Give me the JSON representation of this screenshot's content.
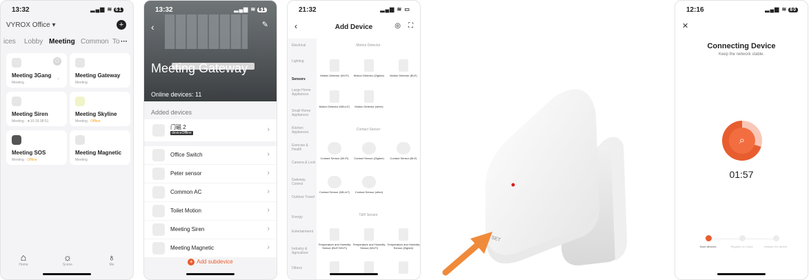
{
  "screen1": {
    "time": "13:32",
    "battery": "61",
    "office": "VYROX Office ▾",
    "add_icon": "plus-icon",
    "tabs": [
      "ices",
      "Lobby",
      "Meeting",
      "Common",
      "To"
    ],
    "more": "···",
    "cards": [
      {
        "name": "Meeting 3Gang",
        "sub": "Meeting",
        "off": ""
      },
      {
        "name": "Meeting Gateway",
        "sub": "Meeting",
        "off": ""
      },
      {
        "name": "Meeting Siren",
        "sub": "Meeting · ★10-18 08:51",
        "off": ""
      },
      {
        "name": "Meeting Skyline",
        "sub": "Meeting ·",
        "off": "Offline"
      },
      {
        "name": "Meeting SOS",
        "sub": "Meeting ·",
        "off": "Offline"
      },
      {
        "name": "Meeting Magnetic",
        "sub": "Meeting",
        "off": ""
      }
    ],
    "tabbar": [
      {
        "label": "Home",
        "icon": "home-icon"
      },
      {
        "label": "Scene",
        "icon": "scene-icon"
      },
      {
        "label": "Me",
        "icon": "me-icon"
      }
    ]
  },
  "screen2": {
    "time": "13:32",
    "battery": "61",
    "title": "Meeting Gateway",
    "online": "Online devices: 11",
    "added_header": "Added devices",
    "rows": [
      {
        "label": "门磁 2",
        "badge": "deviceOffline"
      },
      {
        "label": "Office Switch",
        "badge": ""
      },
      {
        "label": "Peter sensor",
        "badge": ""
      },
      {
        "label": "Common AC",
        "badge": ""
      },
      {
        "label": "Toilet Motion",
        "badge": ""
      },
      {
        "label": "Meeting Siren",
        "badge": ""
      },
      {
        "label": "Meeting Magnetic",
        "badge": ""
      }
    ],
    "add_sub": "Add subdevice"
  },
  "screen3": {
    "time": "21:32",
    "title": "Add Device",
    "categories": [
      "Electrical",
      "Lighting",
      "Sensors",
      "Large Home Appliances",
      "Small Home Appliances",
      "Kitchen Appliances",
      "Exercise & Health",
      "Camera & Lock",
      "Gateway Control",
      "Outdoor Travel",
      "Energy",
      "Entertainment",
      "Industry & Agriculture",
      "Others"
    ],
    "active_category": "Sensors",
    "sections": {
      "motion": "Motion Detector",
      "contact": "Contact Sensor",
      "th": "T&H Sensor"
    },
    "motion_items": [
      "Motion Detector (Wi-Fi)",
      "Motion Detector (Zigbee)",
      "Motion Detector (BLE)",
      "Motion Detector (NB-IoT)",
      "Motion Detector (other)"
    ],
    "contact_items": [
      "Contact Sensor (Wi-Fi)",
      "Contact Sensor (Zigbee)",
      "Contact Sensor (BLE)",
      "Contact Sensor (NB-IoT)",
      "Contact Sensor (other)"
    ],
    "th_items": [
      "Temperature and Humidity Sensor (BLE+Wi-Fi)",
      "Temperature and Humidity Sensor (Wi-Fi)",
      "Temperature and Humidity Sensor (Zigbee)"
    ]
  },
  "product": {
    "label": "SET",
    "arrow_color": "#f08a3b"
  },
  "screen5": {
    "time": "12:16",
    "battery": "80",
    "title": "Connecting Device",
    "subtitle": "Keep the network stable.",
    "timer": "01:57",
    "steps": [
      {
        "label": "Scan devices.",
        "active": true
      },
      {
        "label": "Register on Cloud.",
        "active": false
      },
      {
        "label": "Initialize the device.",
        "active": false
      }
    ],
    "accent": "#e85d2f"
  }
}
